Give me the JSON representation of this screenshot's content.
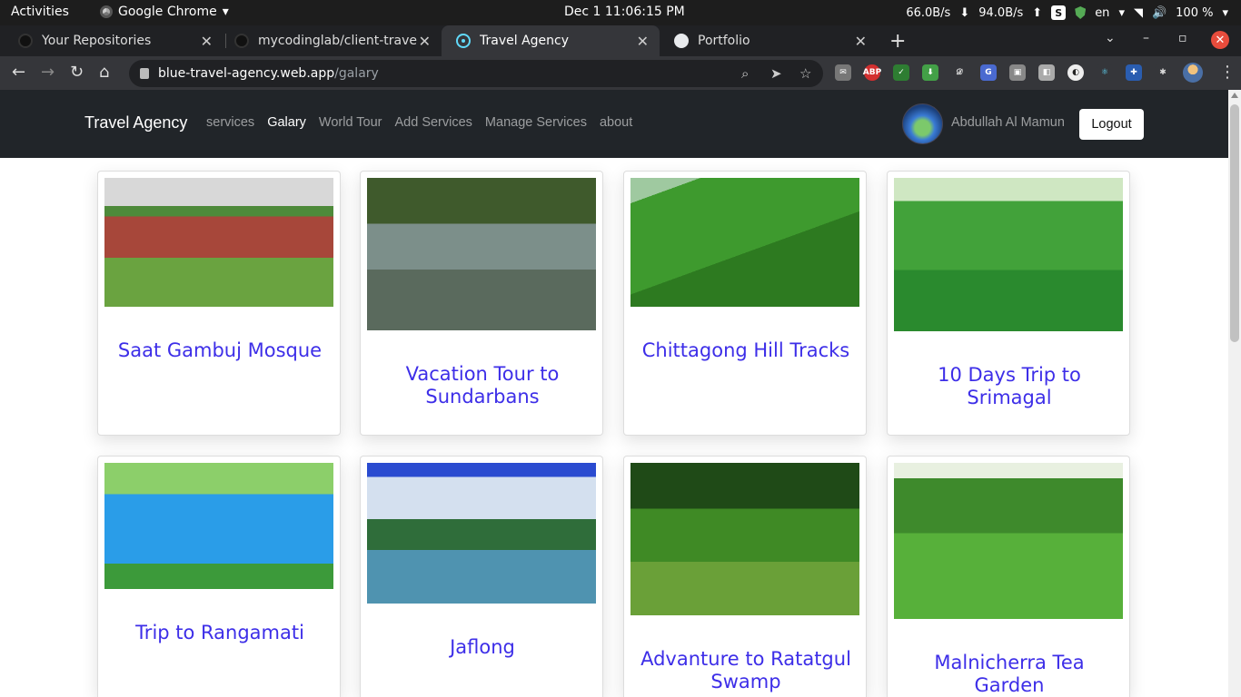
{
  "system_bar": {
    "activities": "Activities",
    "app_name": "Google Chrome",
    "clock": "Dec 1  11:06:15 PM",
    "net_down": "66.0B/s",
    "net_up": "94.0B/s",
    "language": "en",
    "battery": "100 %"
  },
  "browser": {
    "tabs": [
      {
        "label": "Your Repositories",
        "favicon": "github-icon"
      },
      {
        "label": "mycodinglab/client-travel",
        "favicon": "github-icon"
      },
      {
        "label": "Travel Agency",
        "favicon": "react-icon",
        "active": true
      },
      {
        "label": "Portfolio",
        "favicon": "globe-icon"
      }
    ],
    "url_domain": "blue-travel-agency.web.app",
    "url_path": "/galary"
  },
  "site": {
    "brand": "Travel Agency",
    "nav": [
      {
        "label": "services"
      },
      {
        "label": "Galary",
        "active": true
      },
      {
        "label": "World Tour"
      },
      {
        "label": "Add Services"
      },
      {
        "label": "Manage Services"
      },
      {
        "label": "about"
      }
    ],
    "user_name": "Abdullah Al Mamun",
    "logout_label": "Logout",
    "title_color": "#3d2ee8",
    "nav_bg": "#212529"
  },
  "gallery": [
    {
      "title": "Saat Gambuj Mosque"
    },
    {
      "title": "Vacation Tour to Sundarbans"
    },
    {
      "title": "Chittagong Hill Tracks"
    },
    {
      "title": "10 Days Trip to Srimagal"
    },
    {
      "title": "Trip to Rangamati"
    },
    {
      "title": "Jaflong"
    },
    {
      "title": "Advanture to Ratatgul Swamp"
    },
    {
      "title": "Malnicherra Tea Garden"
    }
  ]
}
